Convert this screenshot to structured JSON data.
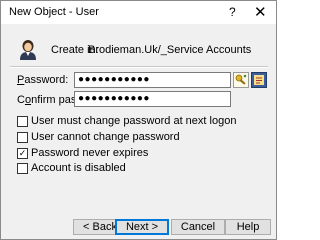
{
  "window": {
    "title": "New Object - User",
    "help_glyph": "?",
    "close_glyph": "✕"
  },
  "header": {
    "icon": "user-icon",
    "create_in_label": "Create in:",
    "create_in_value": "Brodieman.Uk/_Service Accounts"
  },
  "form": {
    "password_label": "Password:",
    "password_value": "●●●●●●●●●●●",
    "confirm_label": "Confirm password:",
    "confirm_value": "●●●●●●●●●●●",
    "password_tools": [
      "password-generator-icon",
      "password-policy-icon"
    ]
  },
  "options": [
    {
      "label": "User must change password at next logon",
      "checked": false
    },
    {
      "label": "User cannot change password",
      "checked": false
    },
    {
      "label": "Password never expires",
      "checked": true
    },
    {
      "label": "Account is disabled",
      "checked": false
    }
  ],
  "buttons": {
    "back": "< Back",
    "next": "Next >",
    "cancel": "Cancel",
    "help": "Help"
  },
  "colors": {
    "window_bg": "#f0f0f0",
    "titlebar_bg": "#ffffff",
    "default_button_border": "#0078d7"
  }
}
